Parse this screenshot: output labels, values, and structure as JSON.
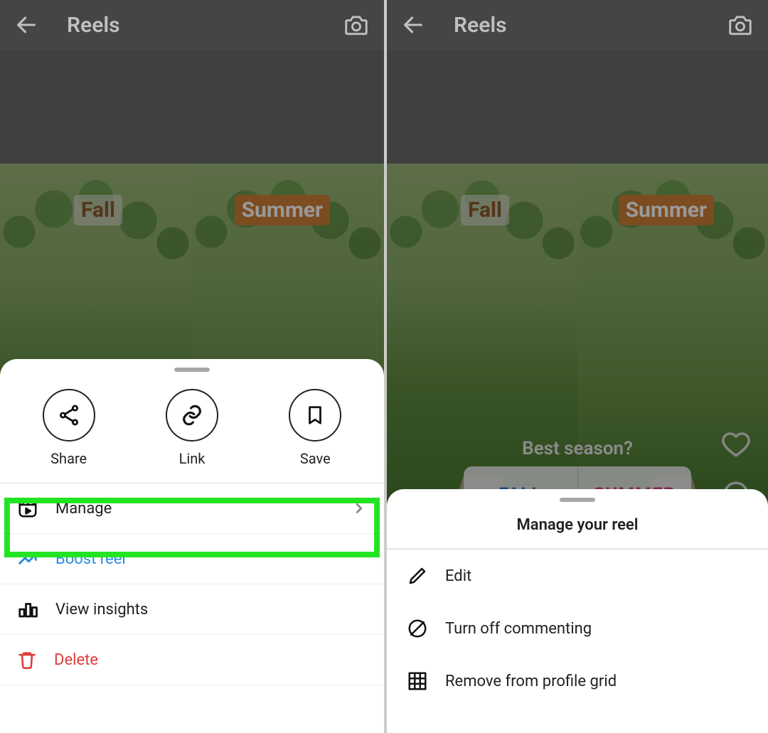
{
  "header": {
    "title": "Reels"
  },
  "reel": {
    "tag_left": "Fall",
    "tag_right": "Summer",
    "poll_question": "Best season?",
    "poll_option_a": "FALL",
    "poll_option_b": "SUMMER"
  },
  "left_sheet": {
    "actions": {
      "share": "Share",
      "link": "Link",
      "save": "Save"
    },
    "menu": {
      "manage": "Manage",
      "boost": "Boost reel",
      "insights": "View insights",
      "delete": "Delete"
    }
  },
  "right_sheet": {
    "title": "Manage your reel",
    "menu": {
      "edit": "Edit",
      "turn_off_commenting": "Turn off commenting",
      "remove_from_grid": "Remove from profile grid"
    }
  },
  "colors": {
    "highlight": "#23e423",
    "link_blue": "#2b8be0",
    "danger_red": "#df3b3b"
  }
}
